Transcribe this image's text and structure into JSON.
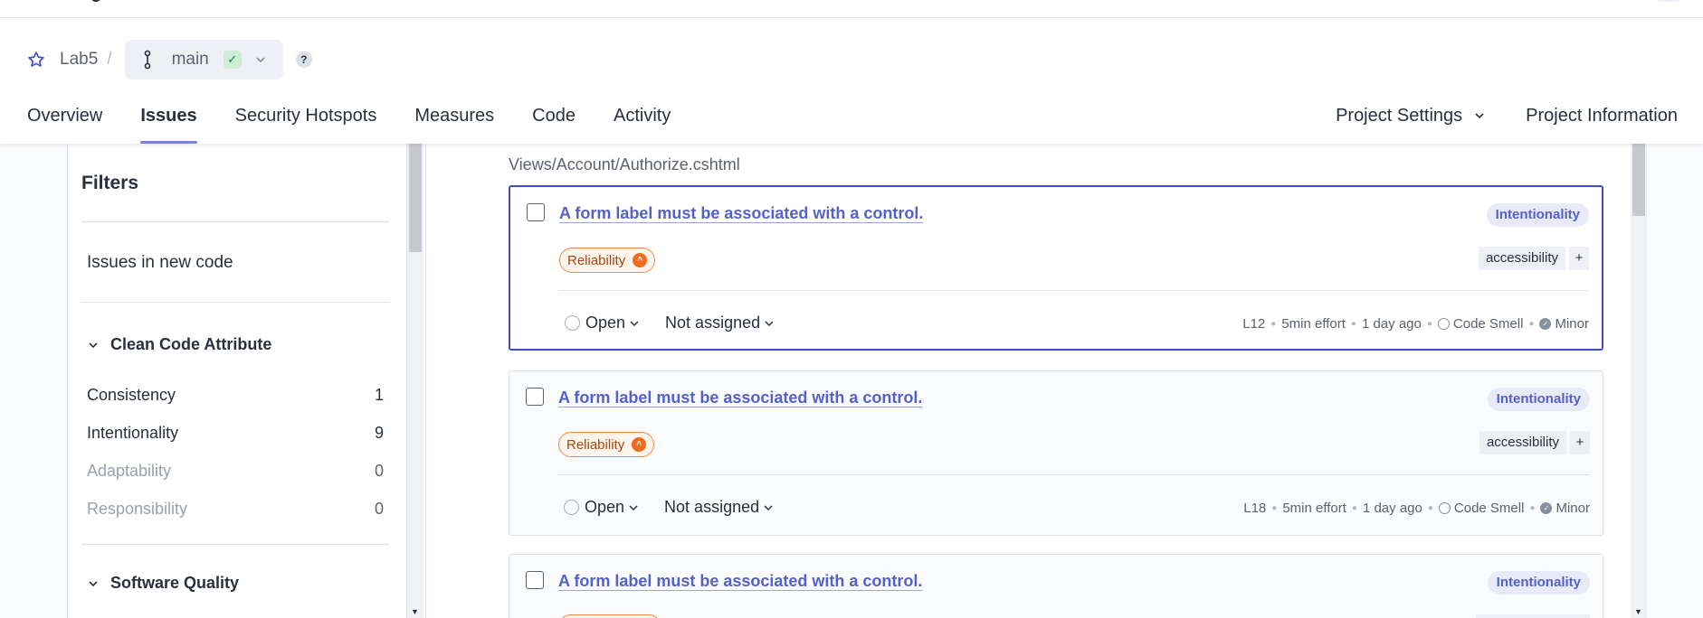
{
  "project": {
    "name": "Lab5",
    "separator": "/",
    "branch": "main",
    "help": "?"
  },
  "nav": {
    "tabs": [
      {
        "label": "Overview"
      },
      {
        "label": "Issues"
      },
      {
        "label": "Security Hotspots"
      },
      {
        "label": "Measures"
      },
      {
        "label": "Code"
      },
      {
        "label": "Activity"
      }
    ],
    "settings": "Project Settings",
    "information": "Project Information"
  },
  "sidebar": {
    "title": "Filters",
    "new_code": "Issues in new code",
    "clean_code": {
      "title": "Clean Code Attribute",
      "items": [
        {
          "label": "Consistency",
          "count": "1"
        },
        {
          "label": "Intentionality",
          "count": "9"
        },
        {
          "label": "Adaptability",
          "count": "0"
        },
        {
          "label": "Responsibility",
          "count": "0"
        }
      ]
    },
    "software_quality": {
      "title": "Software Quality"
    }
  },
  "main": {
    "file_path": "Views/Account/Authorize.cshtml",
    "issues": [
      {
        "title": "A form label must be associated with a control.",
        "attribute": "Intentionality",
        "impact": "Reliability",
        "tag": "accessibility",
        "plus": "+",
        "status": "Open",
        "assignee": "Not assigned",
        "line": "L12",
        "effort": "5min effort",
        "age": "1 day ago",
        "type": "Code Smell",
        "severity": "Minor"
      },
      {
        "title": "A form label must be associated with a control.",
        "attribute": "Intentionality",
        "impact": "Reliability",
        "tag": "accessibility",
        "plus": "+",
        "status": "Open",
        "assignee": "Not assigned",
        "line": "L18",
        "effort": "5min effort",
        "age": "1 day ago",
        "type": "Code Smell",
        "severity": "Minor"
      },
      {
        "title": "A form label must be associated with a control.",
        "attribute": "Intentionality"
      }
    ]
  },
  "colors": {
    "accent": "#3e4ec3",
    "link": "#5461c9",
    "impact_orange": "#f06b1e"
  }
}
